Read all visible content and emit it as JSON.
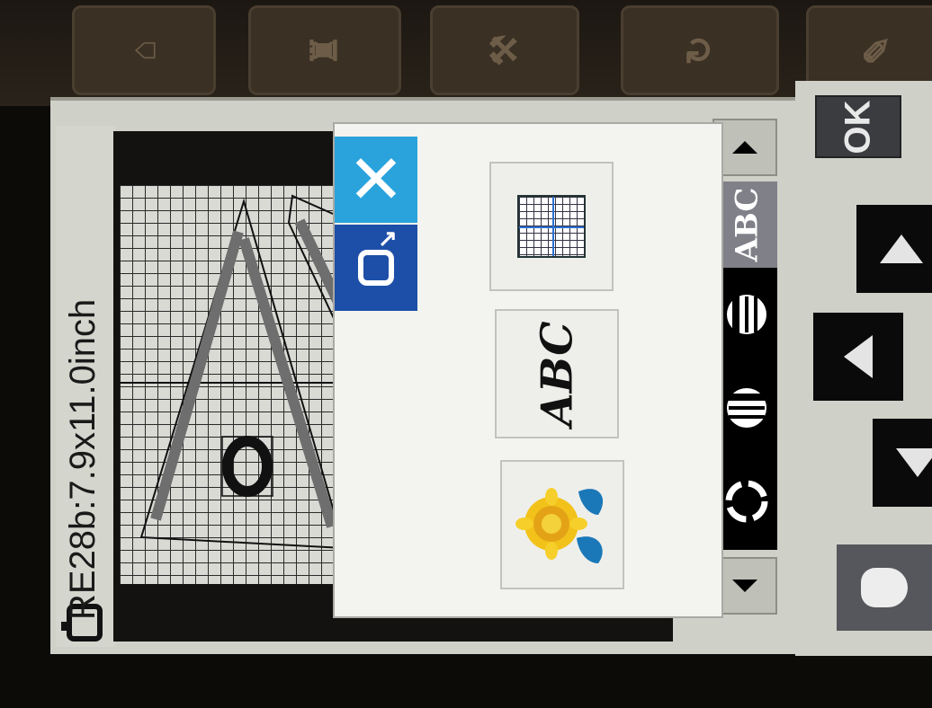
{
  "window": {
    "title": "RE28b:7.9x11.0inch"
  },
  "toolbar": {
    "ok_label": "OK"
  },
  "popup": {
    "close_icon": "close-icon",
    "hoop_icon": "hoop-move-icon",
    "options": [
      {
        "name": "grid-option",
        "icon": "grid-icon"
      },
      {
        "name": "text-option",
        "label": "ABC"
      },
      {
        "name": "pattern-option",
        "icon": "flower-icon"
      }
    ]
  },
  "tools": {
    "abc_label": "ABC"
  },
  "colors": {
    "close_blue": "#2aa3dc",
    "hoop_blue": "#1d4fa8",
    "screen_bg": "#cfd0c8"
  }
}
